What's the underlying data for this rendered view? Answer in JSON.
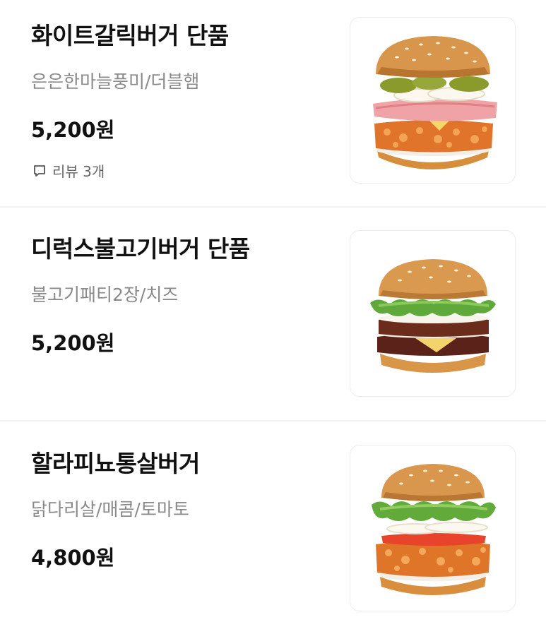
{
  "menu": {
    "items": [
      {
        "name": "화이트갈릭버거 단품",
        "description": "은은한마늘풍미/더블햄",
        "price": "5,200원",
        "review_icon": "speech-bubble-icon",
        "review_label": "리뷰 3개",
        "image_icon": "white-garlic-burger-image"
      },
      {
        "name": "디럭스불고기버거 단품",
        "description": "불고기패티2장/치즈",
        "price": "5,200원",
        "image_icon": "deluxe-bulgogi-burger-image"
      },
      {
        "name": "할라피뇨통살버거",
        "description": "닭다리살/매콤/토마토",
        "price": "4,800원",
        "image_icon": "jalapeno-chicken-burger-image"
      }
    ]
  }
}
